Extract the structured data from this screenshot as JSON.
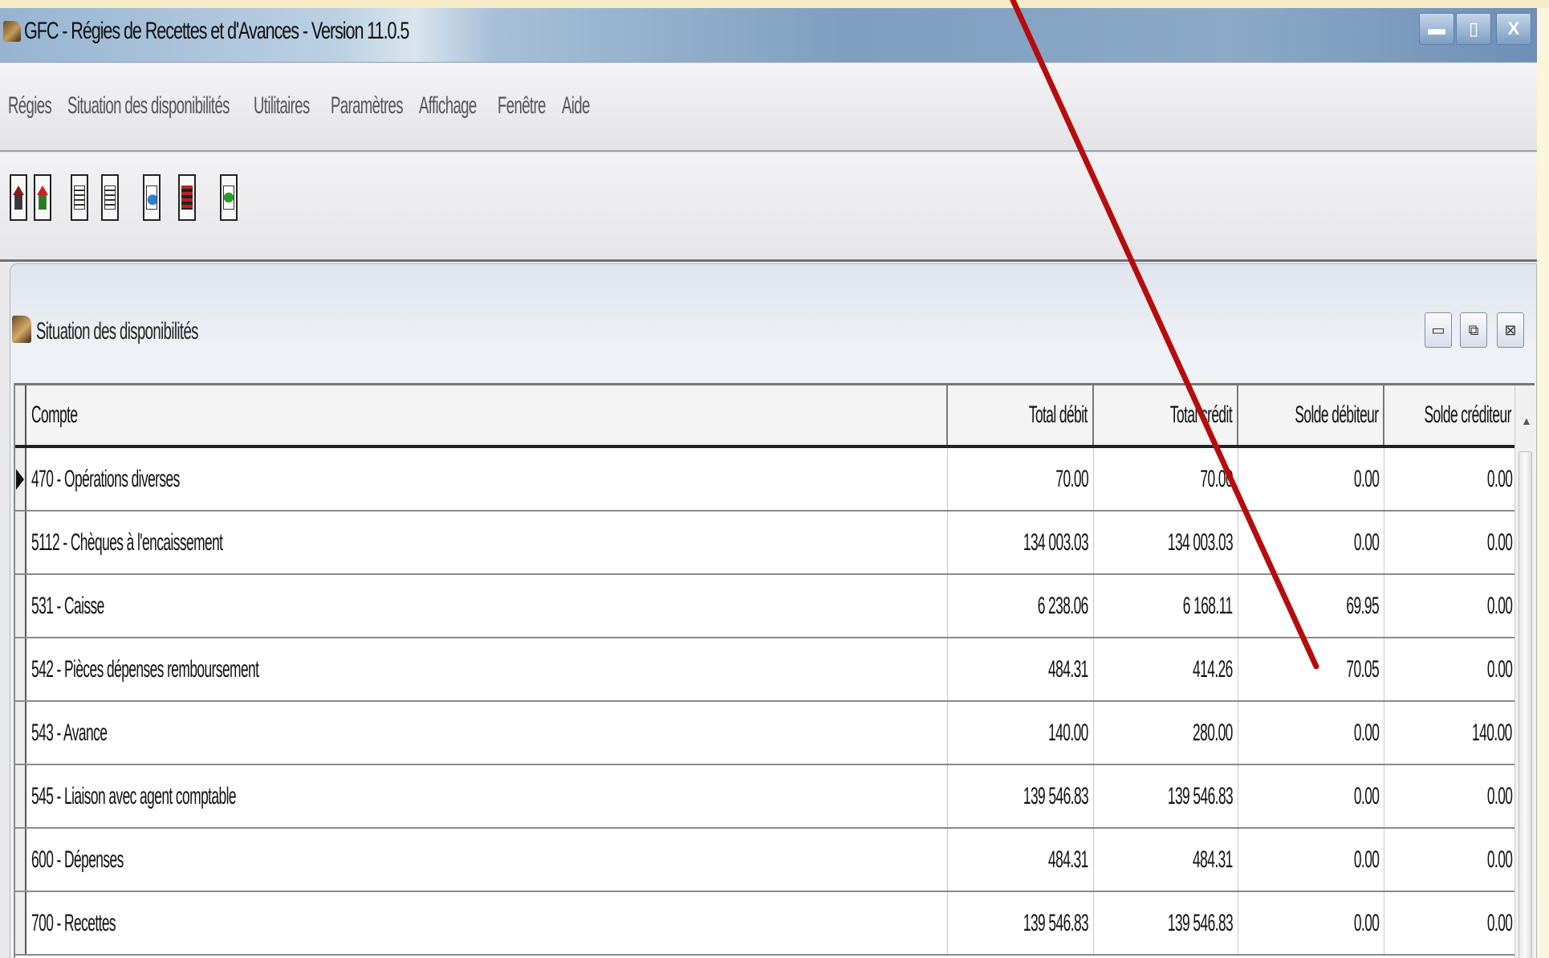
{
  "window": {
    "title": "GFC - Régies de Recettes et d'Avances - Version 11.0.5",
    "controls": {
      "minimize": "▬",
      "maximize": "▯",
      "close": "X"
    }
  },
  "menu": {
    "items": [
      "Régies",
      "Situation des disponibilités",
      "Utilitaires",
      "Paramètres",
      "Affichage",
      "Fenêtre",
      "Aide"
    ]
  },
  "toolbar": {
    "buttons": [
      "home-icon",
      "home-alt-icon",
      "form-icon",
      "form-alt-icon",
      "search-document-icon",
      "list-icon",
      "refresh-document-icon"
    ]
  },
  "child_window": {
    "title": "Situation des disponibilités",
    "controls": {
      "minimize": "▭",
      "restore": "⧉",
      "close": "⊠"
    }
  },
  "grid": {
    "headers": [
      "Compte",
      "Total débit",
      "Total crédit",
      "Solde débiteur",
      "Solde créditeur"
    ],
    "rows": [
      [
        "470 - Opérations diverses",
        "70.00",
        "70.00",
        "0.00",
        "0.00"
      ],
      [
        "5112 - Chèques à l'encaissement",
        "134 003.03",
        "134 003.03",
        "0.00",
        "0.00"
      ],
      [
        "531 - Caisse",
        "6 238.06",
        "6 168.11",
        "69.95",
        "0.00"
      ],
      [
        "542 - Pièces dépenses remboursement",
        "484.31",
        "414.26",
        "70.05",
        "0.00"
      ],
      [
        "543 - Avance",
        "140.00",
        "280.00",
        "0.00",
        "140.00"
      ],
      [
        "545 - Liaison avec agent comptable",
        "139 546.83",
        "139 546.83",
        "0.00",
        "0.00"
      ],
      [
        "600 - Dépenses",
        "484.31",
        "484.31",
        "0.00",
        "0.00"
      ],
      [
        "700 - Recettes",
        "139 546.83",
        "139 546.83",
        "0.00",
        "0.00"
      ]
    ],
    "selected_row": 0
  },
  "annotation": {
    "arrow_color": "#b50d0d"
  }
}
